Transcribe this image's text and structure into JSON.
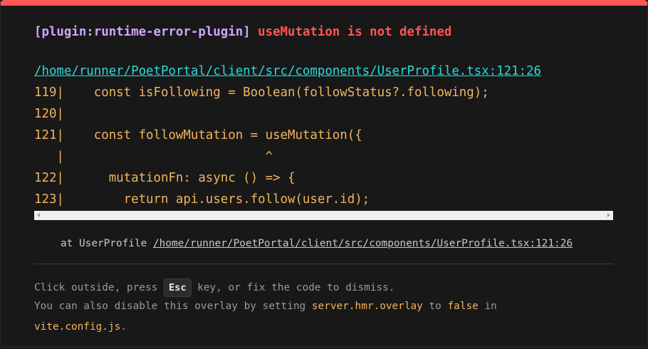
{
  "error": {
    "plugin": "[plugin:runtime-error-plugin]",
    "message": "useMutation is not defined",
    "file": "/home/runner/PoetPortal/client/src/components/UserProfile.tsx:121:26"
  },
  "frame": {
    "lines": [
      "119|    const isFollowing = Boolean(followStatus?.following);",
      "120|",
      "121|    const followMutation = useMutation({",
      "   |                           ^",
      "122|      mutationFn: async () => {",
      "123|        return api.users.follow(user.id);"
    ]
  },
  "stack": {
    "prefix": "at UserProfile ",
    "link": "/home/runner/PoetPortal/client/src/components/UserProfile.tsx:121:26"
  },
  "tip": {
    "line1_before": "Click outside, press ",
    "key": "Esc",
    "line1_after": " key, or fix the code to dismiss.",
    "line2_before": "You can also disable this overlay by setting ",
    "setting": "server.hmr.overlay",
    "line2_mid": " to ",
    "value": "false",
    "line2_after": " in",
    "config_file": "vite.config.js",
    "line3_after": "."
  },
  "colors": {
    "accent": "#ff5555",
    "plugin": "#cfa6ff",
    "link": "#2dd9da",
    "code": "#f4b45c"
  }
}
